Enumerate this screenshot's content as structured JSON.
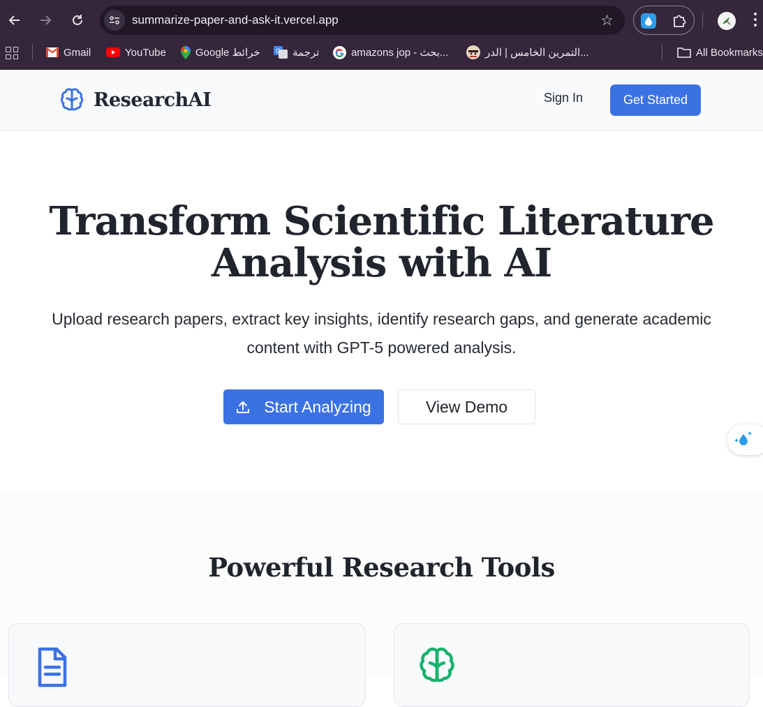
{
  "browser": {
    "url": "summarize-paper-and-ask-it.vercel.app",
    "bookmarks": [
      {
        "label": "Gmail",
        "icon": "gmail-icon"
      },
      {
        "label": "YouTube",
        "icon": "youtube-icon"
      },
      {
        "label": "Google خرائط",
        "icon": "google-maps-icon"
      },
      {
        "label": "ترجمة",
        "icon": "google-translate-icon"
      },
      {
        "label": "amazons jop - بحث...",
        "icon": "google-icon"
      },
      {
        "label": "التمرين الخامس | الدر...",
        "icon": "avatar-icon"
      }
    ],
    "all_bookmarks": "All Bookmarks"
  },
  "header": {
    "logo_text": "ResearchAI",
    "sign_in": "Sign In",
    "get_started": "Get Started"
  },
  "hero": {
    "title_line1": "Transform Scientific Literature",
    "title_line2": "Analysis with AI",
    "subtitle_line1": "Upload research papers, extract key insights, identify research gaps, and generate academic",
    "subtitle_line2": "content with GPT-5 powered analysis.",
    "primary_button": "Start Analyzing",
    "secondary_button": "View Demo"
  },
  "features": {
    "title": "Powerful Research Tools"
  },
  "colors": {
    "accent": "#3b72e3",
    "brain_green": "#16b36c",
    "chrome_bg": "#35263b"
  }
}
